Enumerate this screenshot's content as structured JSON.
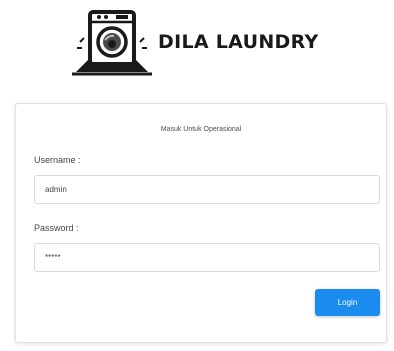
{
  "brand": {
    "name": "DILA LAUNDRY",
    "logo_icon": "washing-machine-icon"
  },
  "login": {
    "title": "Masuk Untuk Operasional",
    "username_label": "Username :",
    "username_value": "admin",
    "password_label": "Password :",
    "password_value": "*****",
    "login_label": "Login"
  },
  "colors": {
    "accent": "#1a8cf0",
    "text": "#1a1a1a"
  }
}
